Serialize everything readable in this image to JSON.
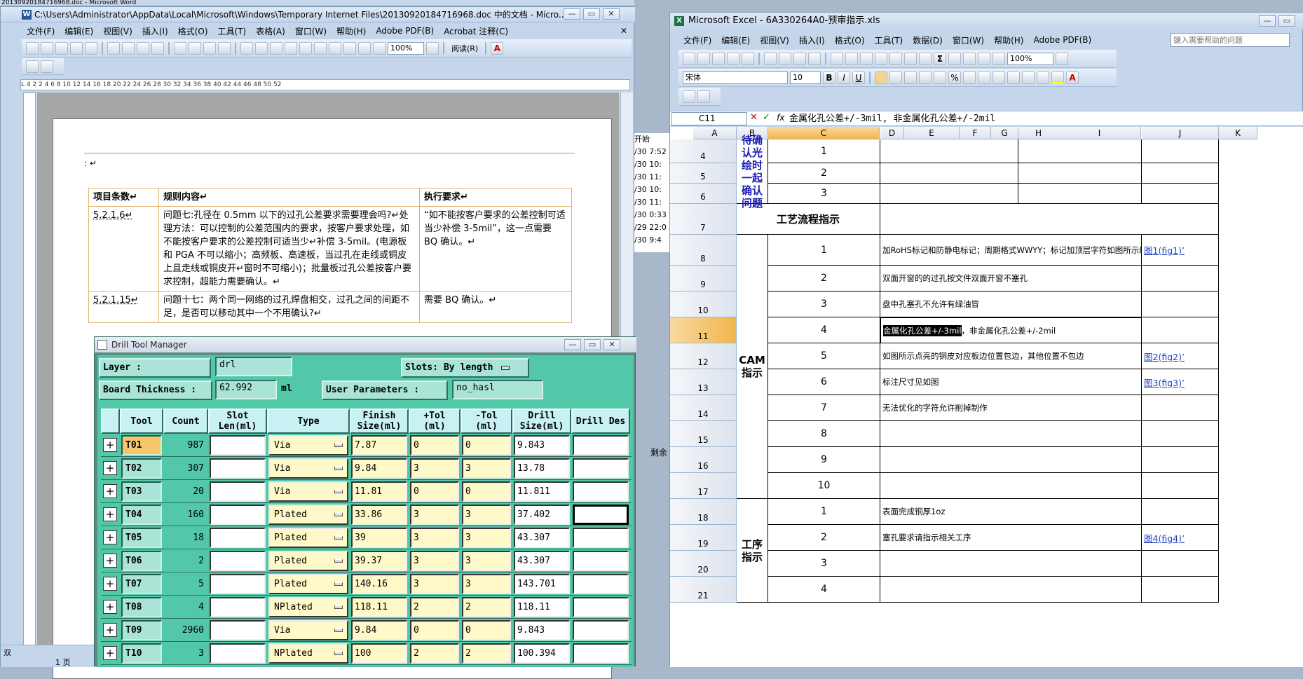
{
  "word": {
    "top_strip": "20130920184716968.doc - Microsoft Word",
    "title": "C:\\Users\\Administrator\\AppData\\Local\\Microsoft\\Windows\\Temporary Internet Files\\20130920184716968.doc 中的文档 - Micro...",
    "menu": [
      "文件(F)",
      "编辑(E)",
      "视图(V)",
      "插入(I)",
      "格式(O)",
      "工具(T)",
      "表格(A)",
      "窗口(W)",
      "帮助(H)",
      "Adobe PDF(B)",
      "Acrobat 注释(C)"
    ],
    "zoom": "100%",
    "read_label": "阅读(R)",
    "ruler_text": "L    4    2         2    4    6    8    10   12   14   16   18   20   22   24   26   28   30   32   34   36   38   40   42   44   46   48   50   52",
    "doc": {
      "prefix": ": ↵",
      "headers": [
        "项目条数↵",
        "规则内容↵",
        "执行要求↵"
      ],
      "rows": [
        {
          "id": "5.2.1.6↵",
          "content": "问题七:孔径在 0.5mm 以下的过孔公差要求需要理会吗?↵处理方法：可以控制的公差范围内的要求，按客户要求处理，如不能按客户要求的公差控制可适当少↵补偿 3-5mil。(电源板和 PGA 不可以缩小；高频板、高速板，当过孔在走线或铜皮上且走线或铜皮开↵窗时不可缩小)；批量板过孔公差按客户要求控制，超能力需要确认。↵",
          "req": "“如不能按客户要求的公差控制可适当少补偿 3-5mil”，这一点需要 BQ 确认。↵"
        },
        {
          "id": "5.2.1.15↵",
          "content": "问题十七：两个同一网络的过孔焊盘相交，过孔之间的间距不足，是否可以移动其中一个不用确认?↵",
          "req": "需要 BQ 确认。↵"
        }
      ]
    },
    "status": {
      "page": "1 页",
      "left_label": "双"
    },
    "side_times": [
      "开始",
      "/30 7:52",
      "/30 10:",
      "/30 11:",
      "/30 10:",
      "/30 11:",
      "/30 0:33",
      "/29 22:0",
      "/30 9:4"
    ],
    "side_other": "剩余"
  },
  "dtm": {
    "title": "Drill Tool Manager",
    "layer_label": "Layer        :",
    "layer_value": "drl",
    "slots_label": "Slots:",
    "slots_value": "By length",
    "thickness_label": "Board Thickness :",
    "thickness_value": "62.992",
    "thickness_unit": "ml",
    "params_label": "User Parameters :",
    "params_value": "no_hasl",
    "headers": [
      "Tool",
      "Count",
      "Slot Len(ml)",
      "Type",
      "Finish Size(ml)",
      "+Tol (ml)",
      "-Tol (ml)",
      "Drill Size(ml)",
      "Drill Des"
    ],
    "rows": [
      {
        "tool": "T01",
        "count": "987",
        "type": "Via",
        "finish": "7.87",
        "ptol": "0",
        "ntol": "0",
        "drill": "9.843"
      },
      {
        "tool": "T02",
        "count": "307",
        "type": "Via",
        "finish": "9.84",
        "ptol": "3",
        "ntol": "3",
        "drill": "13.78"
      },
      {
        "tool": "T03",
        "count": "20",
        "type": "Via",
        "finish": "11.81",
        "ptol": "0",
        "ntol": "0",
        "drill": "11.811"
      },
      {
        "tool": "T04",
        "count": "160",
        "type": "Plated",
        "finish": "33.86",
        "ptol": "3",
        "ntol": "3",
        "drill": "37.402"
      },
      {
        "tool": "T05",
        "count": "18",
        "type": "Plated",
        "finish": "39",
        "ptol": "3",
        "ntol": "3",
        "drill": "43.307"
      },
      {
        "tool": "T06",
        "count": "2",
        "type": "Plated",
        "finish": "39.37",
        "ptol": "3",
        "ntol": "3",
        "drill": "43.307"
      },
      {
        "tool": "T07",
        "count": "5",
        "type": "Plated",
        "finish": "140.16",
        "ptol": "3",
        "ntol": "3",
        "drill": "143.701"
      },
      {
        "tool": "T08",
        "count": "4",
        "type": "NPlated",
        "finish": "118.11",
        "ptol": "2",
        "ntol": "2",
        "drill": "118.11"
      },
      {
        "tool": "T09",
        "count": "2960",
        "type": "Via",
        "finish": "9.84",
        "ptol": "0",
        "ntol": "0",
        "drill": "9.843"
      },
      {
        "tool": "T10",
        "count": "3",
        "type": "NPlated",
        "finish": "100",
        "ptol": "2",
        "ntol": "2",
        "drill": "100.394"
      }
    ]
  },
  "excel": {
    "title": "Microsoft Excel - 6A330264A0-预审指示.xls",
    "menu": [
      "文件(F)",
      "编辑(E)",
      "视图(V)",
      "插入(I)",
      "格式(O)",
      "工具(T)",
      "数据(D)",
      "窗口(W)",
      "帮助(H)",
      "Adobe PDF(B)"
    ],
    "help_placeholder": "键入需要帮助的问题",
    "zoom": "100%",
    "font": "宋体",
    "font_size": "10",
    "name_box": "C11",
    "formula": "金属化孔公差+/-3mil, 非金属化孔公差+/-2mil",
    "columns": [
      "A",
      "B",
      "C",
      "D",
      "E",
      "F",
      "G",
      "H",
      "I",
      "J",
      "K"
    ],
    "rows": [
      "4",
      "5",
      "6",
      "7",
      "8",
      "9",
      "10",
      "11",
      "12",
      "13",
      "14",
      "15",
      "16",
      "17",
      "18",
      "19",
      "20",
      "21"
    ],
    "sections": {
      "confirm": "待确认光绘时一起确认问题",
      "process": "工艺流程指示",
      "cam": "CAM 指示",
      "proc2": "工序指示"
    },
    "items": [
      {
        "n": "1",
        "text": "",
        "link": ""
      },
      {
        "n": "2",
        "text": "",
        "link": ""
      },
      {
        "n": "3",
        "text": "",
        "link": ""
      },
      {
        "n": "1",
        "text": "加RoHS标记和防静电标记；周期格式WWYY；标记加顶层字符如图所示绿色箭头指示的框旁边；",
        "link": "图1(fig1)’"
      },
      {
        "n": "2",
        "text": "双面开窗的的过孔按文件双面开窗不塞孔",
        "link": ""
      },
      {
        "n": "3",
        "text": "盘中孔塞孔不允许有绿油冒",
        "link": ""
      },
      {
        "n": "4",
        "text": "金属化孔公差+/-3mil，非金属化孔公差+/-2mil",
        "link": ""
      },
      {
        "n": "5",
        "text": "如图所示点亮的铜皮对应板边位置包边，其他位置不包边",
        "link": "图2(fig2)’"
      },
      {
        "n": "6",
        "text": "标注尺寸见如图",
        "link": "图3(fig3)’"
      },
      {
        "n": "7",
        "text": "无法优化的字符允许削掉制作",
        "link": ""
      },
      {
        "n": "8",
        "text": "",
        "link": ""
      },
      {
        "n": "9",
        "text": "",
        "link": ""
      },
      {
        "n": "10",
        "text": "",
        "link": ""
      },
      {
        "n": "1",
        "text": "表面完成铜厚1oz",
        "link": ""
      },
      {
        "n": "2",
        "text": "塞孔要求请指示相关工序",
        "link": "图4(fig4)’"
      },
      {
        "n": "3",
        "text": "",
        "link": ""
      },
      {
        "n": "4",
        "text": "",
        "link": ""
      }
    ],
    "selected_fragment": "金属化孔公差+/-3mil",
    "selected_rest": "，非金属化孔公差+/-2mil"
  }
}
